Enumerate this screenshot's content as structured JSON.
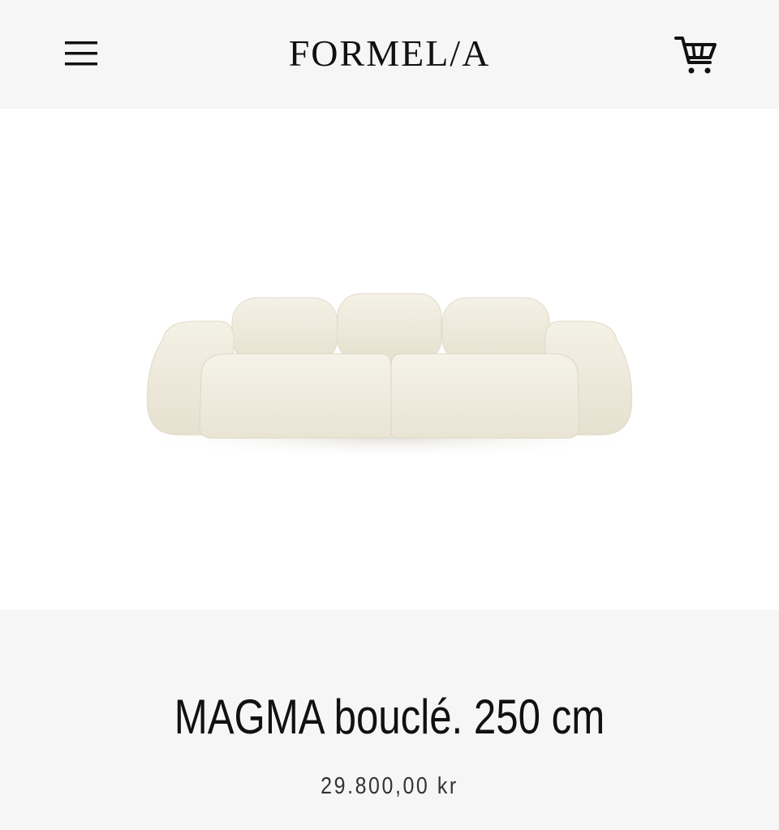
{
  "header": {
    "logo": "FORMEL/A",
    "menu_icon": "hamburger-menu-icon",
    "cart_icon": "shopping-cart-icon"
  },
  "product": {
    "title": "MAGMA bouclé. 250 cm",
    "price": "29.800,00 kr",
    "image_description_icon": "sofa-image"
  },
  "colors": {
    "background": "#f6f6f6",
    "image_background": "#ffffff",
    "sofa": "#f1ede0",
    "text": "#111111"
  }
}
